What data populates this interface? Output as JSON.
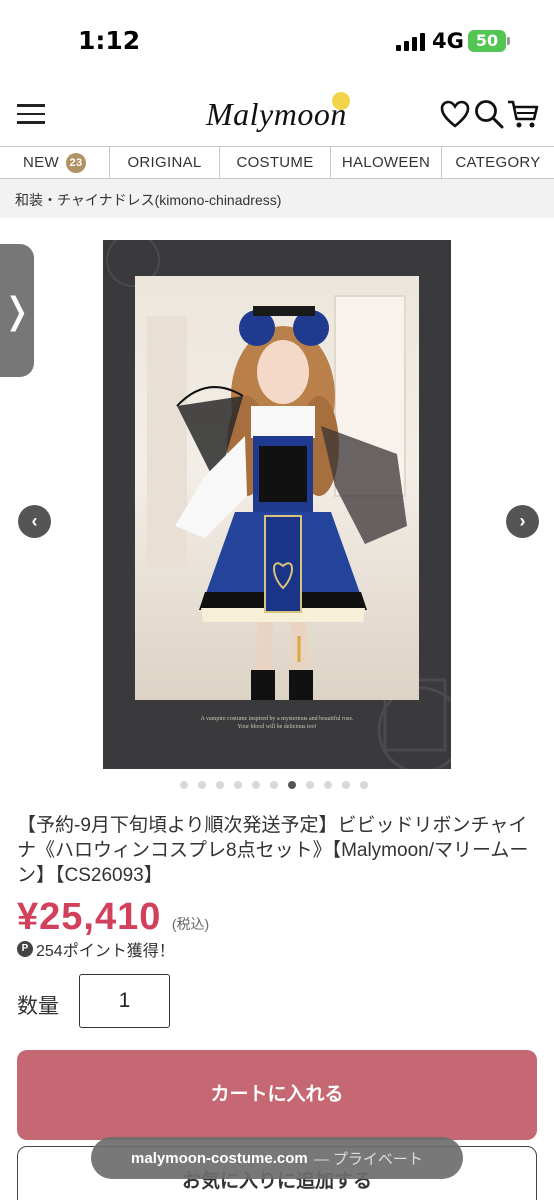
{
  "status_bar": {
    "time": "1:12",
    "network": "4G",
    "battery": "50"
  },
  "header": {
    "logo": "Malymoon",
    "icons": [
      "menu-icon",
      "heart-icon",
      "search-icon",
      "cart-icon"
    ]
  },
  "nav": {
    "items": [
      {
        "label": "NEW",
        "badge": "23"
      },
      {
        "label": "ORIGINAL"
      },
      {
        "label": "COSTUME"
      },
      {
        "label": "HALOWEEN"
      },
      {
        "label": "CATEGORY"
      }
    ]
  },
  "breadcrumb": {
    "text": "和装・チャイナドレス(kimono-chinadress)"
  },
  "product_image": {
    "caption_line1": "A vampire costume inspired by a mysterious and beautiful rose.",
    "caption_line2": "Your blood will be delicious too!",
    "slide_count": 11,
    "active_slide": 6
  },
  "product": {
    "title": "【予約-9月下旬頃より順次発送予定】ビビッドリボンチャイナ《ハロウィンコスプレ8点セット》【Malymoon/マリームーン】【CS26093】",
    "price": "¥25,410",
    "tax_note": "(税込)",
    "points_icon": "P",
    "points": "254ポイント獲得！"
  },
  "quantity": {
    "label": "数量",
    "value": "1"
  },
  "buttons": {
    "add_to_cart": "カートに入れる",
    "add_to_favorites": "お気に入りに追加する"
  },
  "browser": {
    "host": "malymoon-costume.com",
    "mode": "— プライベート"
  },
  "colors": {
    "price": "#d2415c",
    "cart_button": "#c56874",
    "badge": "#b09265"
  }
}
